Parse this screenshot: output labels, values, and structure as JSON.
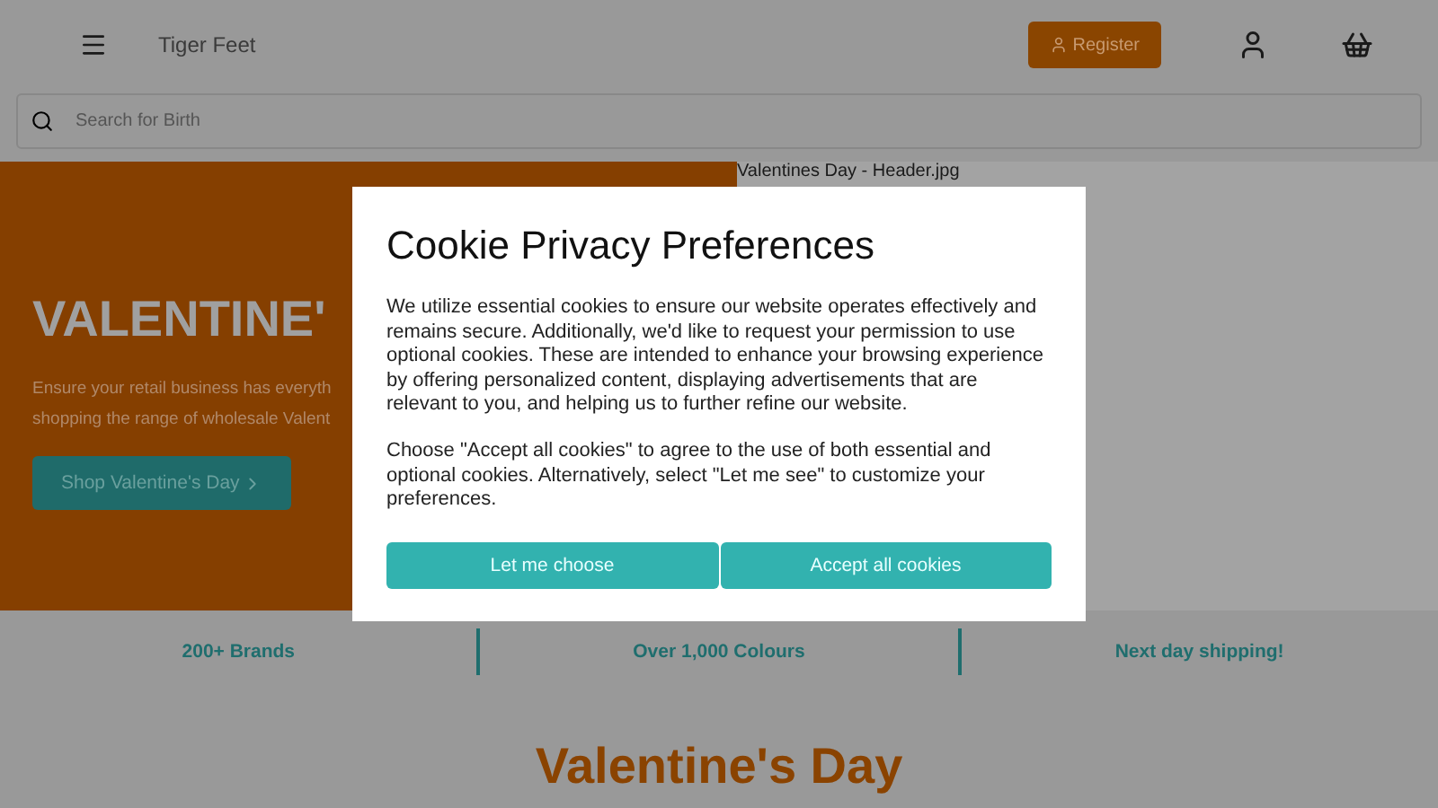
{
  "header": {
    "brand": "Tiger Feet",
    "register_button": "Register"
  },
  "search": {
    "placeholder": "Search for Birth"
  },
  "hero": {
    "heading": "VALENTINE'",
    "text_lines": [
      "Ensure your retail business has everyth",
      "shopping the range of wholesale Valent"
    ],
    "button": "Shop Valentine's Day",
    "image_alt": "Valentines Day - Header.jpg"
  },
  "features": [
    "200+ Brands",
    "Over 1,000 Colours",
    "Next day shipping!"
  ],
  "section_heading": "Valentine's Day",
  "cookie_dialog": {
    "title": "Cookie Privacy Preferences",
    "paragraphs": [
      "We utilize essential cookies to ensure our website operates effectively and remains secure. Additionally, we'd like to request your permission to use optional cookies. These are intended to enhance your browsing experience by offering personalized content, displaying advertisements that are relevant to you, and helping us to further refine our website.",
      "Choose \"Accept all cookies\" to agree to the use of both essential and optional cookies. Alternatively, select \"Let me see\" to customize your preferences."
    ],
    "buttons": [
      "Let me choose",
      "Accept all cookies"
    ]
  }
}
